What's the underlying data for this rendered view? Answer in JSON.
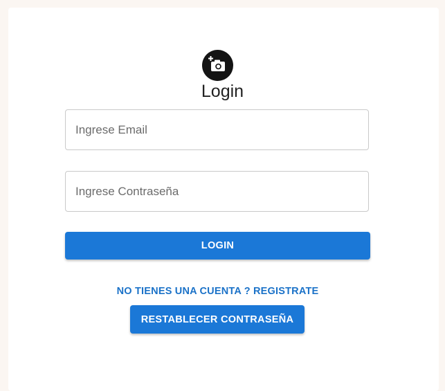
{
  "form": {
    "title": "Login",
    "logo_icon": "add-a-photo-icon",
    "email_placeholder": "Ingrese Email",
    "email_value": "",
    "password_placeholder": "Ingrese Contraseña",
    "password_value": "",
    "login_label": "LOGIN",
    "register_link": "NO TIENES UNA CUENTA ? REGISTRATE",
    "reset_label": "RESTABLECER CONTRASEÑA"
  },
  "colors": {
    "page_background": "#fbf6f2",
    "card_background": "#ffffff",
    "primary": "#1b78d7",
    "link": "#1b72c8",
    "logo_background": "#141414"
  }
}
